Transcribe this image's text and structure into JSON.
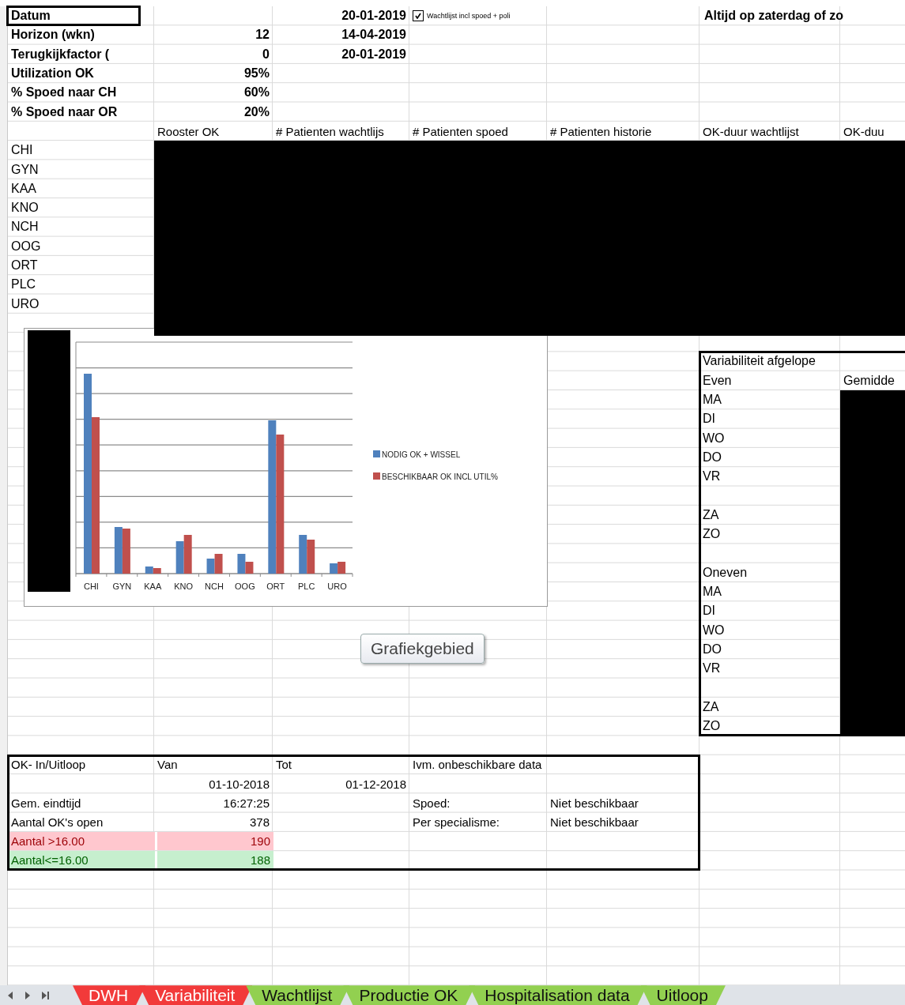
{
  "parameters": [
    {
      "label": "Datum",
      "selected": true
    },
    {
      "label": "Horizon (wkn)",
      "value": "12",
      "selected": false
    },
    {
      "label": "Terugkijkfactor (",
      "value": "0",
      "selected": false
    },
    {
      "label": "Utilization OK",
      "value": "95%",
      "selected": false
    },
    {
      "label": "% Spoed naar CH",
      "value": "60%",
      "selected": false
    },
    {
      "label": "% Spoed naar OR",
      "value": "20%",
      "selected": false
    }
  ],
  "dates": [
    "20-01-2019",
    "14-04-2019",
    "20-01-2019"
  ],
  "checkbox": {
    "label": "Wachtlijst incl spoed + poli",
    "checked": true
  },
  "note": "Altijd op zaterdag of zo",
  "column_headers": [
    "Rooster OK",
    "# Patienten wachtlijs",
    "# Patienten spoed",
    "# Patienten historie",
    "OK-duur wachtlijst",
    "OK-duu"
  ],
  "specialties": [
    "CHI",
    "GYN",
    "KAA",
    "KNO",
    "NCH",
    "OOG",
    "ORT",
    "PLC",
    "URO"
  ],
  "chart": {
    "categories": [
      "CHI",
      "GYN",
      "KAA",
      "KNO",
      "NCH",
      "OOG",
      "ORT",
      "PLC",
      "URO"
    ],
    "legend": [
      {
        "name": "NODIG OK + WISSEL",
        "color": "#4f81bd"
      },
      {
        "name": "BESCHIKBAAR OK INCL UTIL%",
        "color": "#c0504d"
      }
    ]
  },
  "tooltip": "Grafiekgebied",
  "variability": {
    "title": "Variabiliteit afgelope",
    "column_2": "Gemidde",
    "groups": [
      {
        "label": "Even",
        "weekdays": [
          "MA",
          "DI",
          "WO",
          "DO",
          "VR"
        ],
        "weekend": [
          "ZA",
          "ZO"
        ]
      },
      {
        "label": "Oneven",
        "weekdays": [
          "MA",
          "DI",
          "WO",
          "DO",
          "VR"
        ],
        "weekend": [
          "ZA",
          "ZO"
        ]
      }
    ]
  },
  "in_uitloop": {
    "headers": [
      "OK- In/Uitloop",
      "Van",
      "Tot",
      "Ivm. onbeschikbare data"
    ],
    "from": "01-10-2018",
    "to": "01-12-2018",
    "rows": [
      {
        "label": "Gem. eindtijd",
        "value": "16:27:25",
        "kind": "plain"
      },
      {
        "label": "Aantal OK's open",
        "value": "378",
        "kind": "plain"
      },
      {
        "label": "Aantal >16.00",
        "value": "190",
        "kind": "bad"
      },
      {
        "label": "Aantal<=16.00",
        "value": "188",
        "kind": "good"
      }
    ],
    "notes": [
      {
        "label": "Spoed:",
        "value": "Niet beschikbaar"
      },
      {
        "label": "Per specialisme:",
        "value": "Niet beschikbaar"
      }
    ]
  },
  "sheet_tabs": [
    {
      "label": "DWH",
      "color": "#f23a3a"
    },
    {
      "label": "Variabiliteit",
      "color": "#f23a3a"
    },
    {
      "label": "Wachtlijst",
      "color": "#92d050"
    },
    {
      "label": "Productie OK",
      "color": "#92d050"
    },
    {
      "label": "Hospitalisation data",
      "color": "#92d050"
    },
    {
      "label": "Uitloop",
      "color": "#92d050"
    }
  ]
}
